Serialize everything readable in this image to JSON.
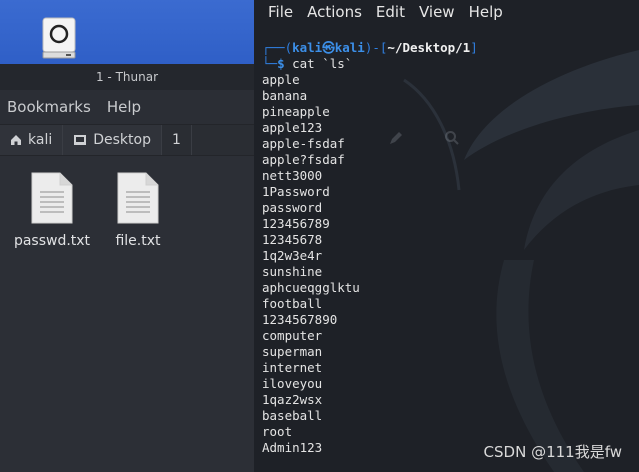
{
  "desktop": {
    "drive_icon": "drive-icon"
  },
  "thunar": {
    "title": "1 - Thunar",
    "menu": [
      "Bookmarks",
      "Help"
    ],
    "pathbar": [
      {
        "label": "kali",
        "icon": "home-icon"
      },
      {
        "label": "Desktop",
        "icon": "folder-icon"
      },
      {
        "label": "1",
        "icon": ""
      }
    ],
    "files": [
      {
        "name": "passwd.txt",
        "icon": "text-file-icon"
      },
      {
        "name": "file.txt",
        "icon": "text-file-icon"
      }
    ]
  },
  "terminal": {
    "menu": [
      "File",
      "Actions",
      "Edit",
      "View",
      "Help"
    ],
    "prompt": {
      "user": "kali",
      "at": "㉿",
      "host": "kali",
      "dir": "~/Desktop/1",
      "command": "cat `ls`"
    },
    "output": [
      "apple",
      "banana",
      "pineapple",
      "apple123",
      "apple-fsdaf",
      "apple?fsdaf",
      "nett3000",
      "1Password",
      "password",
      "123456789",
      "12345678",
      "1q2w3e4r",
      "sunshine",
      "aphcueqgglktu",
      "football",
      "1234567890",
      "computer",
      "superman",
      "internet",
      "iloveyou",
      "1qaz2wsx",
      "baseball",
      "root",
      "Admin123"
    ]
  },
  "watermark": "CSDN @111我是fw"
}
